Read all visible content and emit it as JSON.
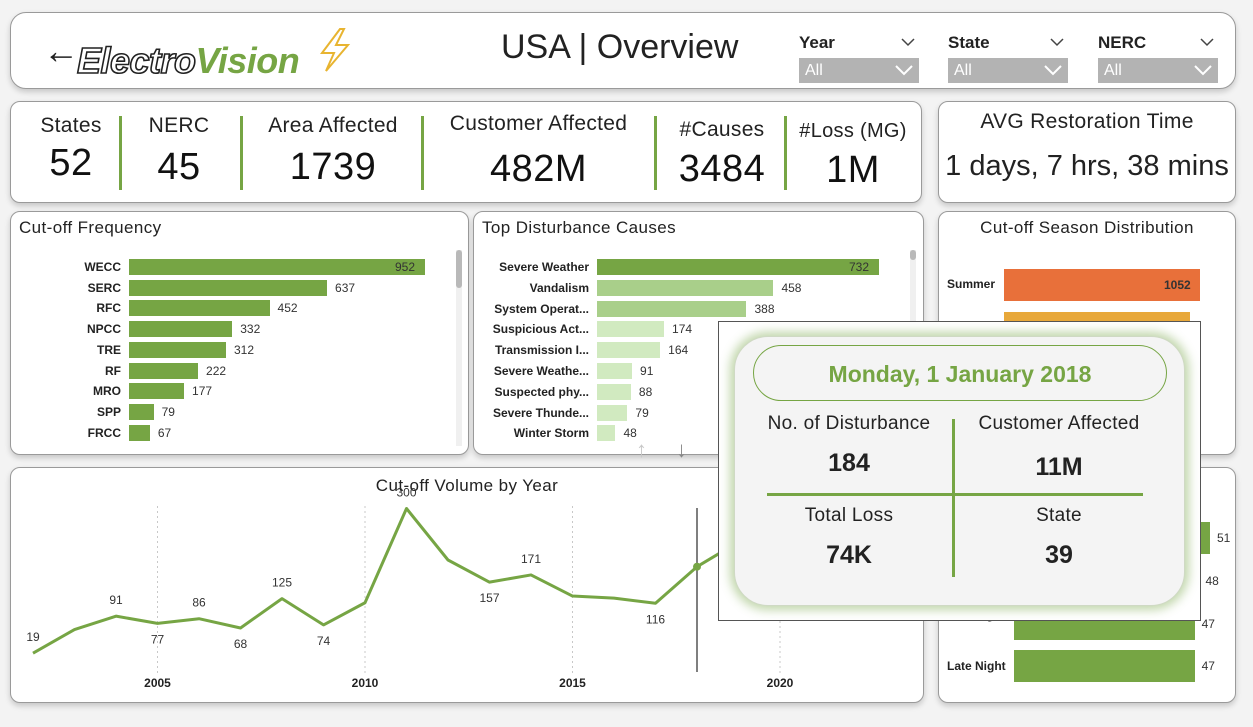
{
  "header": {
    "logo_part1": "Electro",
    "logo_part2": "Vision",
    "title": "USA | Overview",
    "filters": [
      {
        "label": "Year",
        "value": "All"
      },
      {
        "label": "State",
        "value": "All"
      },
      {
        "label": "NERC",
        "value": "All"
      }
    ]
  },
  "kpis": [
    {
      "label": "States",
      "value": "52"
    },
    {
      "label": "NERC",
      "value": "45"
    },
    {
      "label": "Area Affected",
      "value": "1739"
    },
    {
      "label": "Customer Affected",
      "value": "482M"
    },
    {
      "label": "#Causes",
      "value": "3484"
    },
    {
      "label": "#Loss (MG)",
      "value": "1M"
    }
  ],
  "avg_restoration": {
    "label": "AVG Restoration Time",
    "value": "1 days, 7 hrs, 38 mins"
  },
  "colors": {
    "accent": "#76a544",
    "light_green": "#a9cf8a",
    "pale_green": "#d1eac0",
    "orange": "#e8703a",
    "amber": "#e8a83a"
  },
  "chart_data": [
    {
      "type": "bar",
      "title": "Cut-off Frequency",
      "categories": [
        "WECC",
        "SERC",
        "RFC",
        "NPCC",
        "TRE",
        "RF",
        "MRO",
        "SPP",
        "FRCC"
      ],
      "values": [
        952,
        637,
        452,
        332,
        312,
        222,
        177,
        79,
        67
      ]
    },
    {
      "type": "bar",
      "title": "Top Disturbance Causes",
      "categories": [
        "Severe Weather",
        "Vandalism",
        "System Operat...",
        "Suspicious Act...",
        "Transmission I...",
        "Severe Weathe...",
        "Suspected phy...",
        "Severe Thunde...",
        "Winter Storm"
      ],
      "values": [
        732,
        458,
        388,
        174,
        164,
        91,
        88,
        79,
        48
      ]
    },
    {
      "type": "bar",
      "title": "Cut-off Season Distribution",
      "categories": [
        "Summer",
        ""
      ],
      "values": [
        1052,
        1000
      ]
    },
    {
      "type": "line",
      "title": "Cut-off Volume by Year",
      "x": [
        2002,
        2003,
        2004,
        2005,
        2006,
        2007,
        2008,
        2009,
        2010,
        2011,
        2012,
        2013,
        2014,
        2015,
        2016,
        2017,
        2018,
        2019
      ],
      "values": [
        19,
        65,
        91,
        77,
        86,
        68,
        125,
        74,
        117,
        300,
        200,
        157,
        171,
        130,
        126,
        116,
        187,
        235
      ],
      "point_labels": {
        "2002": "19",
        "2004": "91",
        "2005": "77",
        "2006": "86",
        "2007": "68",
        "2008": "125",
        "2009": "74",
        "2011": "300",
        "2013": "157",
        "2014": "171",
        "2017": "116"
      },
      "xticks": [
        "2005",
        "2010",
        "2015",
        "2020"
      ],
      "hover_year": 2018
    },
    {
      "type": "bar",
      "title": "",
      "categories": [
        "",
        "",
        "Evening",
        "Late Night"
      ],
      "values": [
        51,
        48,
        47,
        47
      ]
    }
  ],
  "tooltip": {
    "date": "Monday, 1 January 2018",
    "disturbance_label": "No. of Disturbance",
    "disturbance_value": "184",
    "customer_label": "Customer Affected",
    "customer_value": "11M",
    "loss_label": "Total Loss",
    "loss_value": "74K",
    "state_label": "State",
    "state_value": "39"
  }
}
